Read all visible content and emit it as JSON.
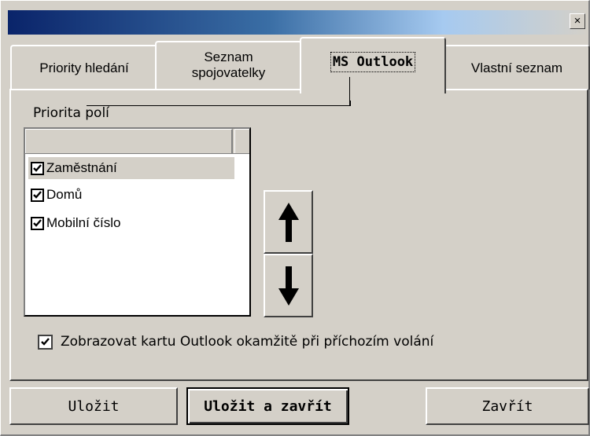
{
  "window": {
    "close_glyph": "×"
  },
  "tabs": [
    {
      "label": "Priority hledání"
    },
    {
      "label_line1": "Seznam",
      "label_line2": "spojovatelky"
    },
    {
      "label": "MS Outlook",
      "active": true
    },
    {
      "label": "Vlastní seznam"
    }
  ],
  "section": {
    "label": "Priorita polí"
  },
  "list": {
    "items": [
      {
        "label": "Zaměstnání",
        "checked": true
      },
      {
        "label": "Domů",
        "checked": true
      },
      {
        "label": "Mobilní číslo",
        "checked": true
      }
    ]
  },
  "arrows": {
    "up_icon": "arrow-up-icon",
    "down_icon": "arrow-down-icon"
  },
  "option": {
    "label": "Zobrazovat kartu Outlook okamžitě při příchozím volání",
    "checked": true
  },
  "buttons": {
    "save": "Uložit",
    "save_close": "Uložit a zavřít",
    "close": "Zavřít"
  },
  "colors": {
    "face": "#d4d0c8",
    "title_start": "#0a246a",
    "title_end": "#a6caf0"
  }
}
